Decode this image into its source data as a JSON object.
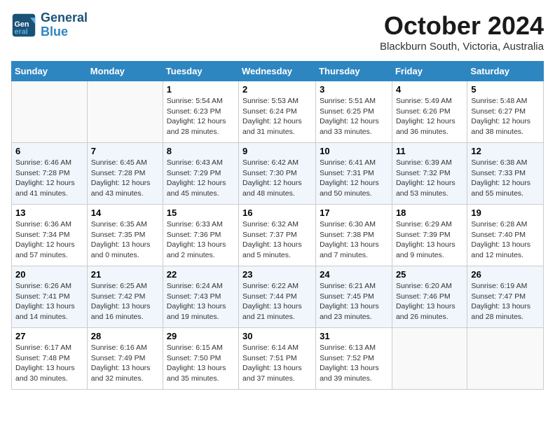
{
  "logo": {
    "line1": "General",
    "line2": "Blue"
  },
  "title": "October 2024",
  "subtitle": "Blackburn South, Victoria, Australia",
  "days_of_week": [
    "Sunday",
    "Monday",
    "Tuesday",
    "Wednesday",
    "Thursday",
    "Friday",
    "Saturday"
  ],
  "weeks": [
    [
      {
        "day": "",
        "sunrise": "",
        "sunset": "",
        "daylight": ""
      },
      {
        "day": "",
        "sunrise": "",
        "sunset": "",
        "daylight": ""
      },
      {
        "day": "1",
        "sunrise": "Sunrise: 5:54 AM",
        "sunset": "Sunset: 6:23 PM",
        "daylight": "Daylight: 12 hours and 28 minutes."
      },
      {
        "day": "2",
        "sunrise": "Sunrise: 5:53 AM",
        "sunset": "Sunset: 6:24 PM",
        "daylight": "Daylight: 12 hours and 31 minutes."
      },
      {
        "day": "3",
        "sunrise": "Sunrise: 5:51 AM",
        "sunset": "Sunset: 6:25 PM",
        "daylight": "Daylight: 12 hours and 33 minutes."
      },
      {
        "day": "4",
        "sunrise": "Sunrise: 5:49 AM",
        "sunset": "Sunset: 6:26 PM",
        "daylight": "Daylight: 12 hours and 36 minutes."
      },
      {
        "day": "5",
        "sunrise": "Sunrise: 5:48 AM",
        "sunset": "Sunset: 6:27 PM",
        "daylight": "Daylight: 12 hours and 38 minutes."
      }
    ],
    [
      {
        "day": "6",
        "sunrise": "Sunrise: 6:46 AM",
        "sunset": "Sunset: 7:28 PM",
        "daylight": "Daylight: 12 hours and 41 minutes."
      },
      {
        "day": "7",
        "sunrise": "Sunrise: 6:45 AM",
        "sunset": "Sunset: 7:28 PM",
        "daylight": "Daylight: 12 hours and 43 minutes."
      },
      {
        "day": "8",
        "sunrise": "Sunrise: 6:43 AM",
        "sunset": "Sunset: 7:29 PM",
        "daylight": "Daylight: 12 hours and 45 minutes."
      },
      {
        "day": "9",
        "sunrise": "Sunrise: 6:42 AM",
        "sunset": "Sunset: 7:30 PM",
        "daylight": "Daylight: 12 hours and 48 minutes."
      },
      {
        "day": "10",
        "sunrise": "Sunrise: 6:41 AM",
        "sunset": "Sunset: 7:31 PM",
        "daylight": "Daylight: 12 hours and 50 minutes."
      },
      {
        "day": "11",
        "sunrise": "Sunrise: 6:39 AM",
        "sunset": "Sunset: 7:32 PM",
        "daylight": "Daylight: 12 hours and 53 minutes."
      },
      {
        "day": "12",
        "sunrise": "Sunrise: 6:38 AM",
        "sunset": "Sunset: 7:33 PM",
        "daylight": "Daylight: 12 hours and 55 minutes."
      }
    ],
    [
      {
        "day": "13",
        "sunrise": "Sunrise: 6:36 AM",
        "sunset": "Sunset: 7:34 PM",
        "daylight": "Daylight: 12 hours and 57 minutes."
      },
      {
        "day": "14",
        "sunrise": "Sunrise: 6:35 AM",
        "sunset": "Sunset: 7:35 PM",
        "daylight": "Daylight: 13 hours and 0 minutes."
      },
      {
        "day": "15",
        "sunrise": "Sunrise: 6:33 AM",
        "sunset": "Sunset: 7:36 PM",
        "daylight": "Daylight: 13 hours and 2 minutes."
      },
      {
        "day": "16",
        "sunrise": "Sunrise: 6:32 AM",
        "sunset": "Sunset: 7:37 PM",
        "daylight": "Daylight: 13 hours and 5 minutes."
      },
      {
        "day": "17",
        "sunrise": "Sunrise: 6:30 AM",
        "sunset": "Sunset: 7:38 PM",
        "daylight": "Daylight: 13 hours and 7 minutes."
      },
      {
        "day": "18",
        "sunrise": "Sunrise: 6:29 AM",
        "sunset": "Sunset: 7:39 PM",
        "daylight": "Daylight: 13 hours and 9 minutes."
      },
      {
        "day": "19",
        "sunrise": "Sunrise: 6:28 AM",
        "sunset": "Sunset: 7:40 PM",
        "daylight": "Daylight: 13 hours and 12 minutes."
      }
    ],
    [
      {
        "day": "20",
        "sunrise": "Sunrise: 6:26 AM",
        "sunset": "Sunset: 7:41 PM",
        "daylight": "Daylight: 13 hours and 14 minutes."
      },
      {
        "day": "21",
        "sunrise": "Sunrise: 6:25 AM",
        "sunset": "Sunset: 7:42 PM",
        "daylight": "Daylight: 13 hours and 16 minutes."
      },
      {
        "day": "22",
        "sunrise": "Sunrise: 6:24 AM",
        "sunset": "Sunset: 7:43 PM",
        "daylight": "Daylight: 13 hours and 19 minutes."
      },
      {
        "day": "23",
        "sunrise": "Sunrise: 6:22 AM",
        "sunset": "Sunset: 7:44 PM",
        "daylight": "Daylight: 13 hours and 21 minutes."
      },
      {
        "day": "24",
        "sunrise": "Sunrise: 6:21 AM",
        "sunset": "Sunset: 7:45 PM",
        "daylight": "Daylight: 13 hours and 23 minutes."
      },
      {
        "day": "25",
        "sunrise": "Sunrise: 6:20 AM",
        "sunset": "Sunset: 7:46 PM",
        "daylight": "Daylight: 13 hours and 26 minutes."
      },
      {
        "day": "26",
        "sunrise": "Sunrise: 6:19 AM",
        "sunset": "Sunset: 7:47 PM",
        "daylight": "Daylight: 13 hours and 28 minutes."
      }
    ],
    [
      {
        "day": "27",
        "sunrise": "Sunrise: 6:17 AM",
        "sunset": "Sunset: 7:48 PM",
        "daylight": "Daylight: 13 hours and 30 minutes."
      },
      {
        "day": "28",
        "sunrise": "Sunrise: 6:16 AM",
        "sunset": "Sunset: 7:49 PM",
        "daylight": "Daylight: 13 hours and 32 minutes."
      },
      {
        "day": "29",
        "sunrise": "Sunrise: 6:15 AM",
        "sunset": "Sunset: 7:50 PM",
        "daylight": "Daylight: 13 hours and 35 minutes."
      },
      {
        "day": "30",
        "sunrise": "Sunrise: 6:14 AM",
        "sunset": "Sunset: 7:51 PM",
        "daylight": "Daylight: 13 hours and 37 minutes."
      },
      {
        "day": "31",
        "sunrise": "Sunrise: 6:13 AM",
        "sunset": "Sunset: 7:52 PM",
        "daylight": "Daylight: 13 hours and 39 minutes."
      },
      {
        "day": "",
        "sunrise": "",
        "sunset": "",
        "daylight": ""
      },
      {
        "day": "",
        "sunrise": "",
        "sunset": "",
        "daylight": ""
      }
    ]
  ]
}
